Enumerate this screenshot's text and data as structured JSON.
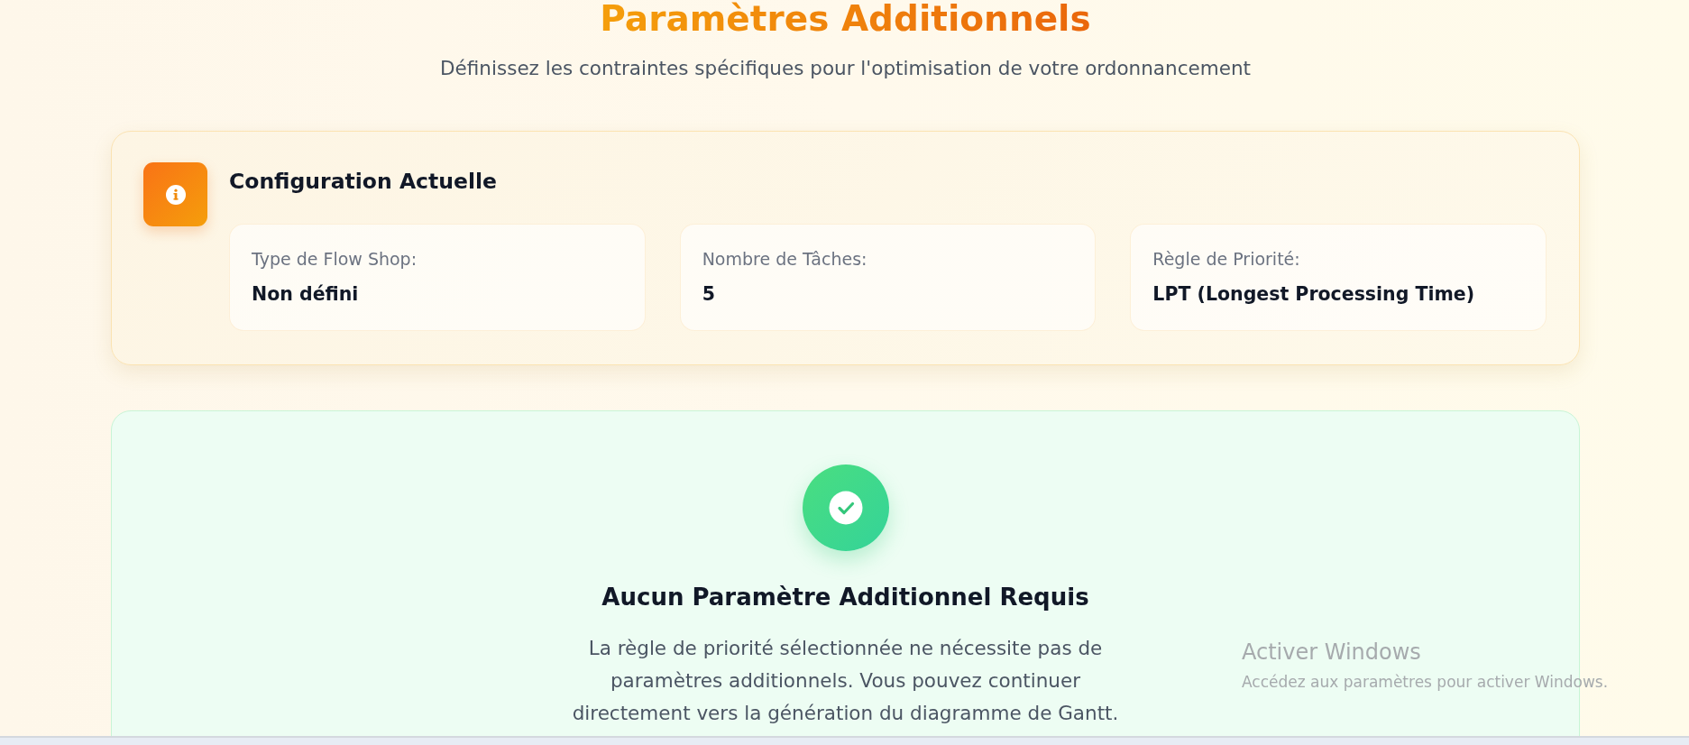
{
  "header": {
    "title": "Paramètres Additionnels",
    "subtitle": "Définissez les contraintes spécifiques pour l'optimisation de votre ordonnancement"
  },
  "configuration": {
    "title": "Configuration Actuelle",
    "items": [
      {
        "label": "Type de Flow Shop:",
        "value": "Non défini"
      },
      {
        "label": "Nombre de Tâches:",
        "value": "5"
      },
      {
        "label": "Règle de Priorité:",
        "value": "LPT (Longest Processing Time)"
      }
    ]
  },
  "notice": {
    "title": "Aucun Paramètre Additionnel Requis",
    "message": "La règle de priorité sélectionnée ne nécessite pas de paramètres additionnels. Vous pouvez continuer directement vers la génération du diagramme de Gantt."
  },
  "windows_activation": {
    "title": "Activer Windows",
    "message": "Accédez aux paramètres pour activer Windows."
  }
}
